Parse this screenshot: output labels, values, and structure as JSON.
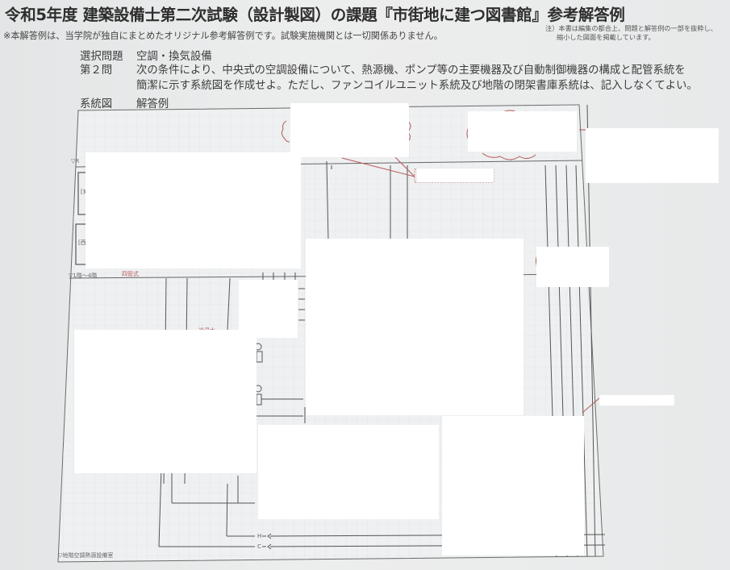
{
  "header": {
    "title": "令和5年度 建築設備士第二次試験（設計製図）の課題『市街地に建つ図書館』参考解答例",
    "disclaimer": "※本解答例は、当学院が独自にまとめたオリジナル参考解答例です。試験実施機関とは一切関係ありません。",
    "note_line1": "注）本書は編集の都合上、問題と解答例の一部を抜粋し、",
    "note_line2": "縮小した図面を掲載しています。"
  },
  "problem": {
    "selection_label": "選択問題",
    "selection_value": "空調・換気設備",
    "question_label": "第２問",
    "question_line1": "次の条件により、中央式の空調設備について、熱源機、ポンプ等の主要機器及び自動制御機器の構成と配管系統を",
    "question_line2": "簡潔に示す系統図を作成せよ。ただし、ファンコイルユニット系統及び地階の閉架書庫系統は、記入しなくてよい。",
    "diagram_label": "系統図",
    "diagram_value": "解答例"
  },
  "diagram": {
    "floor_labels": {
      "top": "▽R",
      "mid": "▽1階～4階",
      "basement": "▽地階空調熱源設備室"
    },
    "room_tags": [
      "[東",
      "[西"
    ],
    "pipe_labels": [
      "H",
      "C"
    ],
    "annotation_mid": "四管式",
    "annotation_low": "冷温水",
    "colors": {
      "line": "#555555",
      "grid": "#cfd3d6",
      "annotation": "#b85a5a",
      "mask": "#ffffff"
    }
  }
}
